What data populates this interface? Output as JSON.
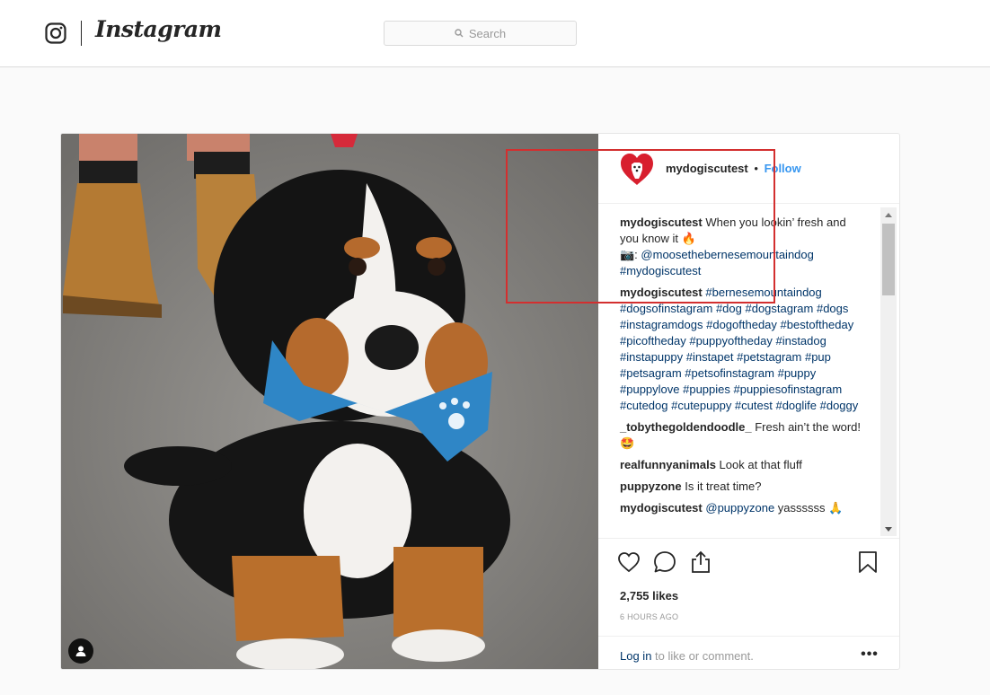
{
  "header": {
    "logo_text": "Instagram",
    "search_placeholder": "Search"
  },
  "post": {
    "username": "mydogiscutest",
    "separator": "•",
    "follow_label": "Follow",
    "comments": [
      {
        "user": "mydogiscutest",
        "text_1": " When you lookin’ fresh and you know it 🔥",
        "prefix_2": "📷: ",
        "mention": "@moosethebernesemountaindog",
        "tag": "#mydogiscutest"
      },
      {
        "user": "mydogiscutest",
        "tags": "#bernesemountaindog #dogsofinstagram #dog #dogstagram #dogs #instagramdogs #dogoftheday #bestoftheday #picoftheday #puppyoftheday #instadog #instapuppy #instapet #petstagram #pup #petsagram #petsofinstagram #puppy #puppylove #puppies #puppiesofinstagram #cutedog #cutepuppy #cutest #doglife #doggy"
      },
      {
        "user": "_tobythegoldendoodle_",
        "text": " Fresh ain’t the word! 🤩"
      },
      {
        "user": "realfunnyanimals",
        "text": " Look at that fluff"
      },
      {
        "user": "puppyzone",
        "text": " Is it treat time?"
      },
      {
        "user": "mydogiscutest",
        "mention": "@puppyzone",
        "text": " yassssss 🙏"
      }
    ],
    "likes": "2,755 likes",
    "time": "6 HOURS AGO",
    "login_link": "Log in",
    "login_text": " to like or comment.",
    "more_label": "•••"
  },
  "colors": {
    "link_blue": "#3897f0",
    "hashtag_blue": "#003569",
    "highlight_red": "#d32f2f"
  },
  "icons": [
    "instagram-camera-icon",
    "search-icon",
    "heart-logo-icon",
    "user-tag-icon",
    "heart-icon",
    "comment-icon",
    "share-icon",
    "bookmark-icon",
    "more-icon"
  ]
}
